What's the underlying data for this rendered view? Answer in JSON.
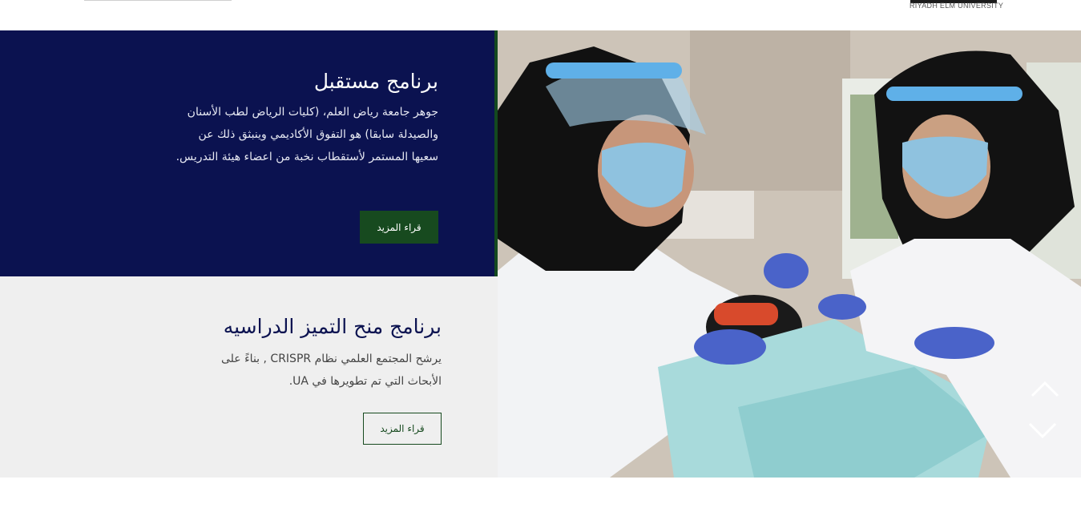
{
  "header": {
    "logo_text": "RIYADH ELM UNIVERSITY"
  },
  "programs": [
    {
      "title": "برنامج مستقبل",
      "body": "جوهر جامعة رياض العلم، (كليات الرياض لطب الأسنان والصيدلة سابقا) هو التفوق الأكاديمي وينبثق ذلك عن سعيها المستمر لأستقطاب نخبة من اعضاء هيئة التدريس.",
      "button_label": "قراء المزيد"
    },
    {
      "title": "برنامج منح التميز الدراسيه",
      "body": "يرشح المجتمع العلمي نظام CRISPR , بناءً على الأبحاث التي تم تطويرها في UA.",
      "button_label": "قراء المزيد"
    }
  ],
  "slider": {
    "image_name": "dental-clinic-photo",
    "prev_icon": "chevron-up-icon",
    "next_icon": "chevron-down-icon"
  },
  "colors": {
    "navy": "#0b1250",
    "green": "#174a1f",
    "light_gray": "#efefef"
  }
}
